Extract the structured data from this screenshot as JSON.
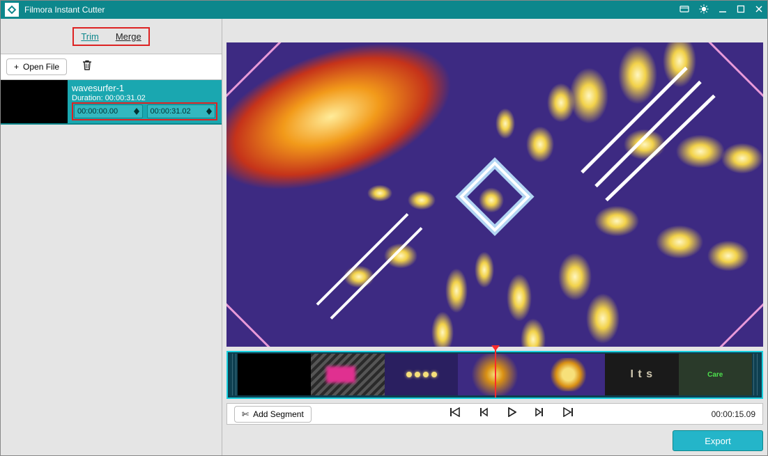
{
  "window": {
    "title": "Filmora Instant Cutter"
  },
  "tabs": {
    "trim": "Trim",
    "merge": "Merge"
  },
  "actions": {
    "open_file": "Open File",
    "add_segment": "Add Segment",
    "export": "Export"
  },
  "clip": {
    "name": "wavesurfer-1",
    "duration_label": "Duration: 00:00:31.02",
    "start_time": "00:00:00.00",
    "end_time": "00:00:31.02"
  },
  "playback": {
    "current_time": "00:00:15.09"
  },
  "icons": {
    "plus": "+",
    "scissors": "✄"
  }
}
